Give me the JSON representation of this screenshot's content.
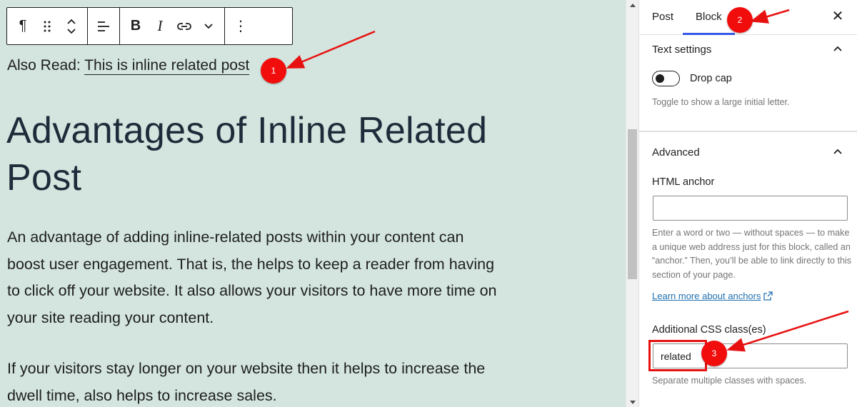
{
  "editor": {
    "also_read_prefix": "Also Read:",
    "also_read_link": "This is inline related post",
    "heading_line1": "Advantages of Inline Related",
    "heading_line2": "Post",
    "paragraph1": "An advantage of adding inline-related posts within your content can boost user engagement. That is, the helps to keep a reader from having to click off your website. It also allows your visitors to have more time on your site reading your content.",
    "paragraph2": "If your visitors stay longer on your website then it helps to increase the dwell time, also helps to increase sales."
  },
  "toolbar": {
    "icons": [
      "paragraph-icon",
      "drag-handle-icon",
      "move-up-down-icon",
      "align-icon",
      "bold-icon",
      "italic-icon",
      "link-icon",
      "more-formatting-chevron-icon",
      "options-kebab-icon"
    ],
    "paragraph_glyph": "¶",
    "bold_label": "B",
    "italic_label": "I",
    "kebab_glyph": "⋮"
  },
  "sidebar": {
    "tabs": [
      {
        "label": "Post",
        "active": false
      },
      {
        "label": "Block",
        "active": true
      }
    ],
    "close_glyph": "✕",
    "text_settings": {
      "title": "Text settings",
      "drop_cap_label": "Drop cap",
      "drop_cap_on": false,
      "help": "Toggle to show a large initial letter."
    },
    "advanced": {
      "title": "Advanced",
      "html_anchor_label": "HTML anchor",
      "html_anchor_value": "",
      "html_anchor_help": "Enter a word or two — without spaces — to make a unique web address just for this block, called an “anchor.” Then, you’ll be able to link directly to this section of your page.",
      "learn_more": "Learn more about anchors",
      "css_label": "Additional CSS class(es)",
      "css_value": "related",
      "css_help": "Separate multiple classes with spaces."
    }
  },
  "annotations": {
    "badges": [
      "1",
      "2",
      "3"
    ],
    "color": "#f20d0d"
  },
  "colors": {
    "canvas_bg": "#d3e5de",
    "accent": "#3858e9",
    "link": "#2271b1"
  }
}
